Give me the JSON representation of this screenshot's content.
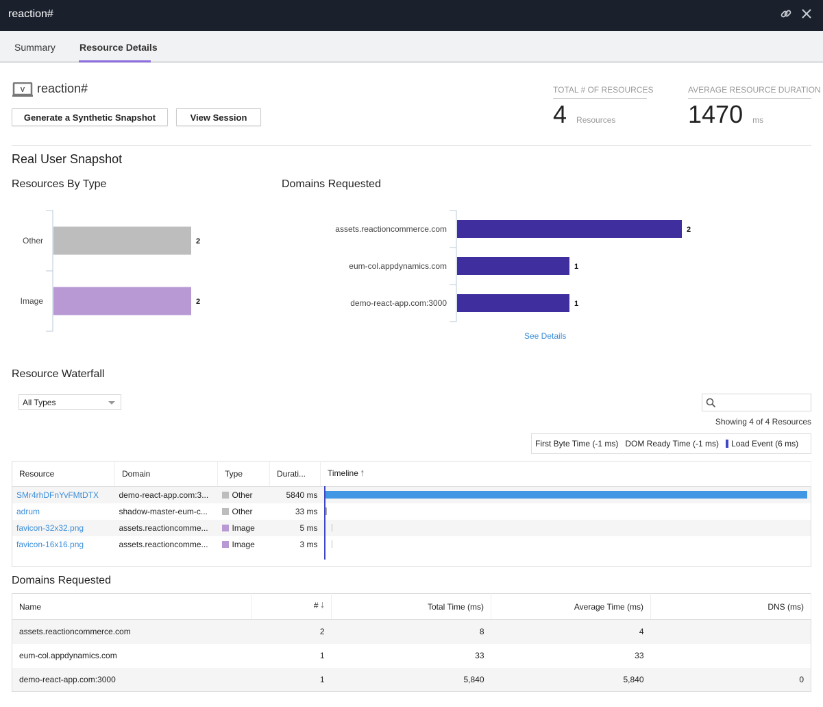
{
  "window": {
    "title": "reaction#"
  },
  "tabs": [
    {
      "label": "Summary",
      "active": false
    },
    {
      "label": "Resource Details",
      "active": true
    }
  ],
  "header": {
    "app_name": "reaction#",
    "buttons": {
      "synthetic": "Generate a Synthetic Snapshot",
      "view_session": "View Session"
    },
    "stats": [
      {
        "label": "TOTAL # OF RESOURCES",
        "value": "4",
        "unit": "Resources"
      },
      {
        "label": "AVERAGE RESOURCE DURATION",
        "value": "1470",
        "unit": "ms"
      }
    ]
  },
  "sections": {
    "real_user": "Real User Snapshot",
    "by_type": "Resources By Type",
    "domains": "Domains Requested",
    "see_details": "See Details",
    "waterfall": "Resource Waterfall",
    "domains_table": "Domains Requested"
  },
  "chart_data": [
    {
      "type": "bar",
      "orientation": "horizontal",
      "title": "Resources By Type",
      "categories": [
        "Other",
        "Image"
      ],
      "values": [
        2,
        2
      ],
      "colors": [
        "#bdbdbd",
        "#b899d4"
      ],
      "xlim": [
        0,
        2
      ]
    },
    {
      "type": "bar",
      "orientation": "horizontal",
      "title": "Domains Requested",
      "categories": [
        "assets.reactioncommerce.com",
        "eum-col.appdynamics.com",
        "demo-react-app.com:3000"
      ],
      "values": [
        2,
        1,
        1
      ],
      "colors": [
        "#3f2f9e",
        "#3f2f9e",
        "#3f2f9e"
      ],
      "xlim": [
        0,
        2
      ]
    }
  ],
  "waterfall": {
    "filter": "All Types",
    "search_placeholder": "",
    "showing": "Showing 4 of 4 Resources",
    "legend": [
      "First Byte Time (-1 ms)",
      "DOM Ready Time (-1 ms)",
      "Load Event (6 ms)"
    ],
    "columns": [
      "Resource",
      "Domain",
      "Type",
      "Durati...",
      "Timeline"
    ],
    "max_ms": 5840,
    "rows": [
      {
        "resource": "SMr4rhDFnYvFMtDTX",
        "domain": "demo-react-app.com:3...",
        "type": "Other",
        "type_color": "#bdbdbd",
        "duration": "5840 ms",
        "ms": 5840,
        "bar_color": "#4297e4"
      },
      {
        "resource": "adrum",
        "domain": "shadow-master-eum-c...",
        "type": "Other",
        "type_color": "#bdbdbd",
        "duration": "33 ms",
        "ms": 33,
        "bar_color": "#aaaaaa"
      },
      {
        "resource": "favicon-32x32.png",
        "domain": "assets.reactioncomme...",
        "type": "Image",
        "type_color": "#b899d4",
        "duration": "5 ms",
        "ms": 5,
        "bar_color": "#bbbbbb"
      },
      {
        "resource": "favicon-16x16.png",
        "domain": "assets.reactioncomme...",
        "type": "Image",
        "type_color": "#b899d4",
        "duration": "3 ms",
        "ms": 3,
        "bar_color": "#bbbbbb"
      }
    ]
  },
  "domains_table": {
    "columns": [
      "Name",
      "#",
      "Total Time (ms)",
      "Average Time (ms)",
      "DNS (ms)"
    ],
    "rows": [
      {
        "name": "assets.reactioncommerce.com",
        "count": "2",
        "total": "8",
        "avg": "4",
        "dns": ""
      },
      {
        "name": "eum-col.appdynamics.com",
        "count": "1",
        "total": "33",
        "avg": "33",
        "dns": ""
      },
      {
        "name": "demo-react-app.com:3000",
        "count": "1",
        "total": "5,840",
        "avg": "5,840",
        "dns": "0"
      }
    ]
  }
}
